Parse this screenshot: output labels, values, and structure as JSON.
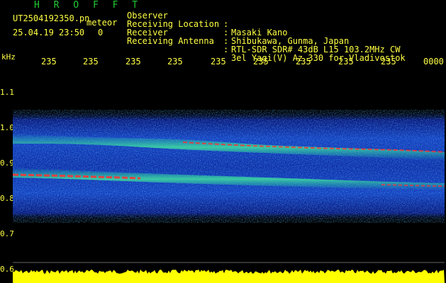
{
  "header": {
    "title": "H R O F F T",
    "filename": "UT2504192350.pn",
    "label": "meteor",
    "date_time": "25.04.19 23:50",
    "count": "0"
  },
  "metadata": [
    {
      "key": "Observer",
      "value": "Masaki Kano"
    },
    {
      "key": "Receiving Location",
      "value": "Shibukawa, Gunma, Japan"
    },
    {
      "key": "Receiver",
      "value": "RTL-SDR SDR# 43dB L15 103.2MHz CW"
    },
    {
      "key": "Receiving Antenna",
      "value": "3el Yagi(V) Az 330 for Vladivostok"
    }
  ],
  "axis": {
    "unit_label": "kHz",
    "time_ticks": [
      "235",
      "235",
      "235",
      "235",
      "235",
      "235",
      "235",
      "235",
      "235",
      "0000"
    ],
    "freq_ticks": [
      "1.1",
      "1.0",
      "0.9",
      "0.8",
      "0.7",
      "0.6"
    ]
  },
  "colors": {
    "text": "#ffff44",
    "title": "#22cc33",
    "background": "#000000",
    "noise_floor": "#0a1a88",
    "signal_mid": "#20c8a0",
    "signal_hot": "#ff2a2a",
    "amplitude": "#ffff00"
  }
}
